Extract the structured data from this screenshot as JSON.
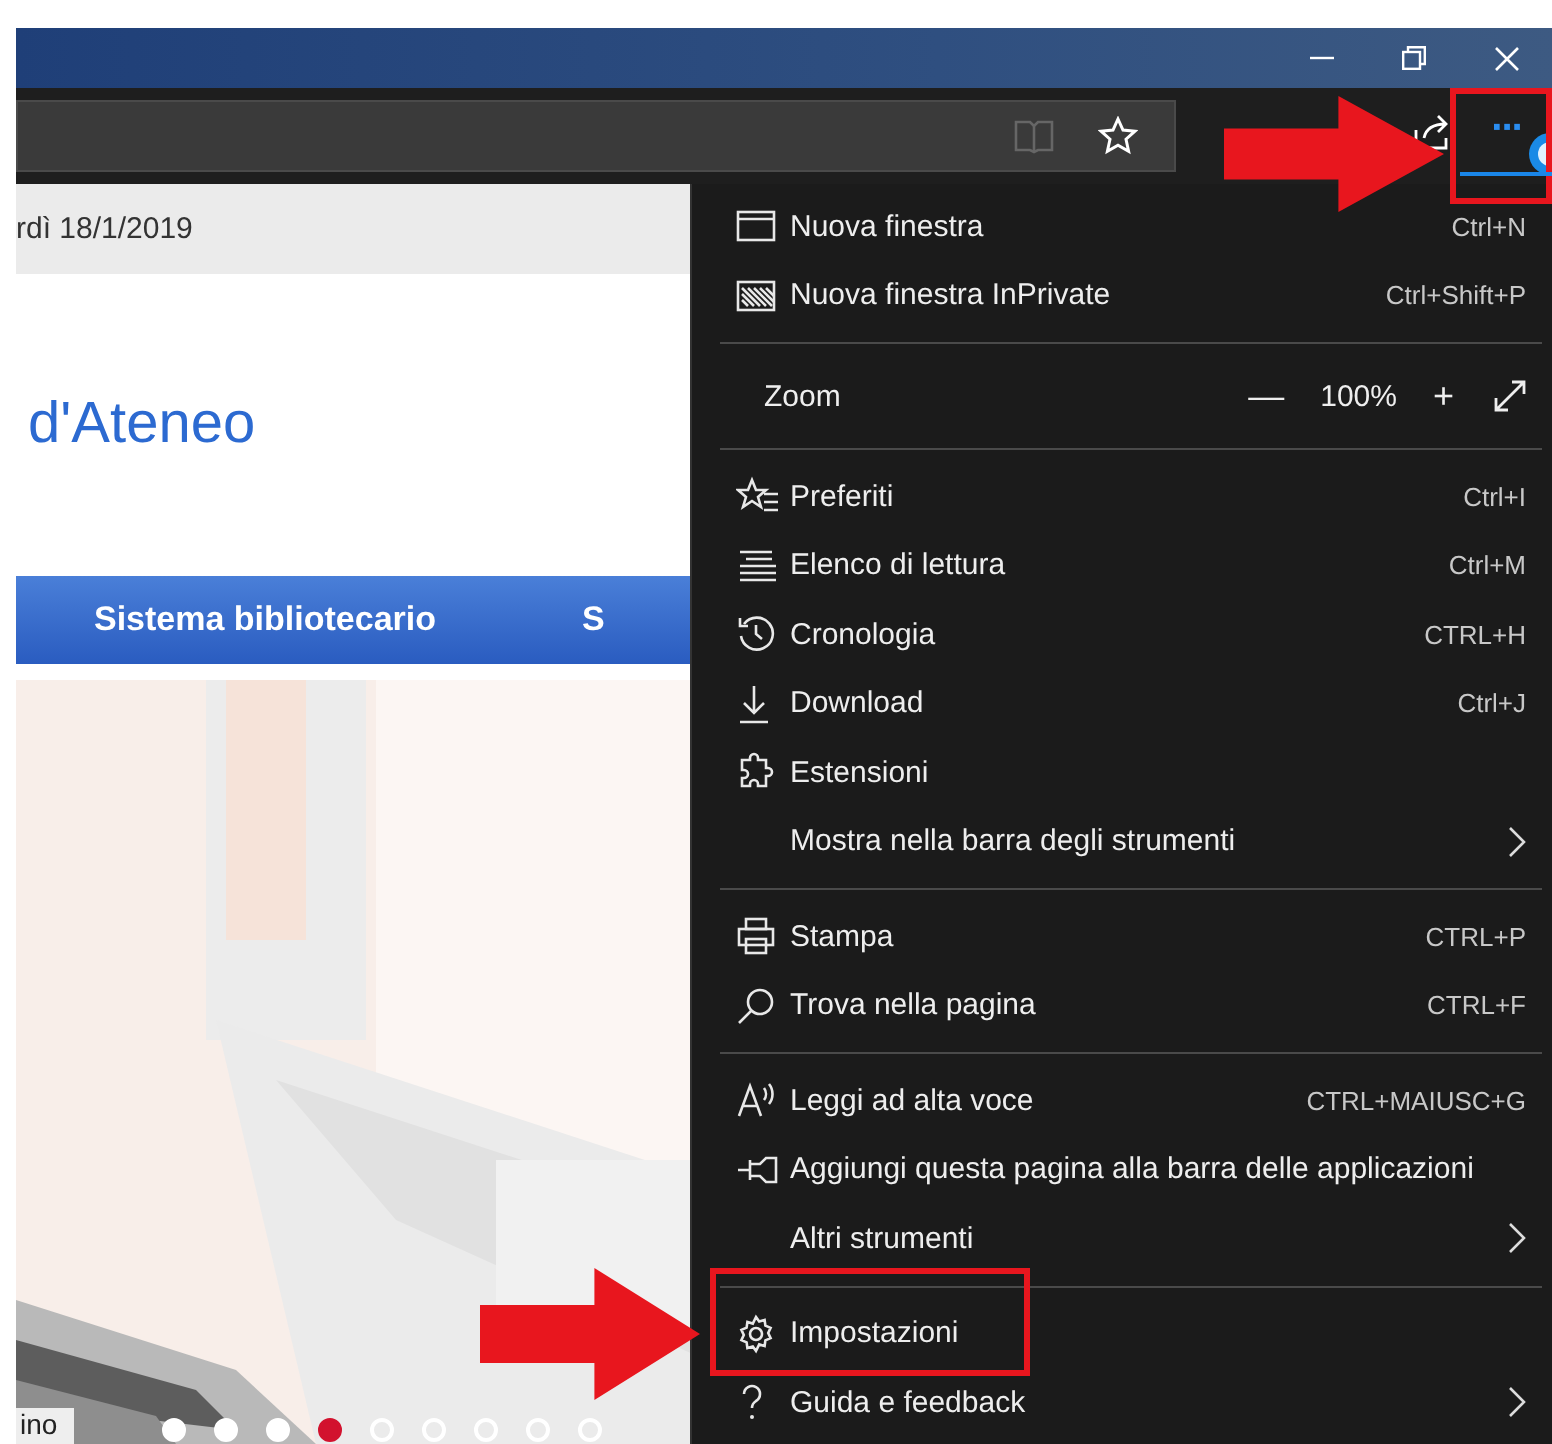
{
  "toolbar": {
    "more_button": {
      "label": "···",
      "selected": true
    }
  },
  "page": {
    "date": "rdì 18/1/2019",
    "heading": "d'Ateneo",
    "nav": [
      "Sistema bibliotecario",
      "S"
    ],
    "caption": "ino",
    "carousel": [
      {
        "selected": false,
        "filled": true
      },
      {
        "selected": false,
        "filled": true
      },
      {
        "selected": false,
        "filled": true
      },
      {
        "selected": true,
        "filled": true
      },
      {
        "selected": false,
        "filled": false
      },
      {
        "selected": false,
        "filled": false
      },
      {
        "selected": false,
        "filled": false
      },
      {
        "selected": false,
        "filled": false
      },
      {
        "selected": false,
        "filled": false
      }
    ]
  },
  "menu": [
    {
      "kind": "item",
      "label": "Nuova finestra",
      "shortcut": "Ctrl+N",
      "submenu": false
    },
    {
      "kind": "item",
      "label": "Nuova finestra InPrivate",
      "shortcut": "Ctrl+Shift+P",
      "submenu": false
    },
    {
      "kind": "separator"
    },
    {
      "kind": "zoom",
      "label": "Zoom",
      "minus": "—",
      "value": "100%",
      "plus": "+"
    },
    {
      "kind": "separator"
    },
    {
      "kind": "item",
      "label": "Preferiti",
      "shortcut": "Ctrl+I",
      "submenu": false
    },
    {
      "kind": "item",
      "label": "Elenco di lettura",
      "shortcut": "Ctrl+M",
      "submenu": false
    },
    {
      "kind": "item",
      "label": "Cronologia",
      "shortcut": "CTRL+H",
      "submenu": false
    },
    {
      "kind": "item",
      "label": "Download",
      "shortcut": "Ctrl+J",
      "submenu": false
    },
    {
      "kind": "item",
      "label": "Estensioni",
      "submenu": false
    },
    {
      "kind": "item",
      "label": "Mostra nella barra degli strumenti",
      "submenu": true
    },
    {
      "kind": "separator"
    },
    {
      "kind": "item",
      "label": "Stampa",
      "shortcut": "CTRL+P",
      "submenu": false
    },
    {
      "kind": "item",
      "label": "Trova nella pagina",
      "shortcut": "CTRL+F",
      "submenu": false
    },
    {
      "kind": "separator"
    },
    {
      "kind": "item",
      "label": "Leggi ad alta voce",
      "shortcut": "CTRL+MAIUSC+G",
      "submenu": false
    },
    {
      "kind": "item",
      "label": "Aggiungi questa pagina alla barra delle applicazioni",
      "submenu": false
    },
    {
      "kind": "item",
      "label": "Altri strumenti",
      "submenu": true
    },
    {
      "kind": "separator"
    },
    {
      "kind": "item",
      "label": "Impostazioni",
      "submenu": false
    },
    {
      "kind": "item",
      "label": "Guida e feedback",
      "submenu": true
    }
  ],
  "annotations": [
    {
      "kind": "arrow"
    },
    {
      "kind": "frame"
    },
    {
      "kind": "arrow"
    },
    {
      "kind": "frame"
    }
  ]
}
